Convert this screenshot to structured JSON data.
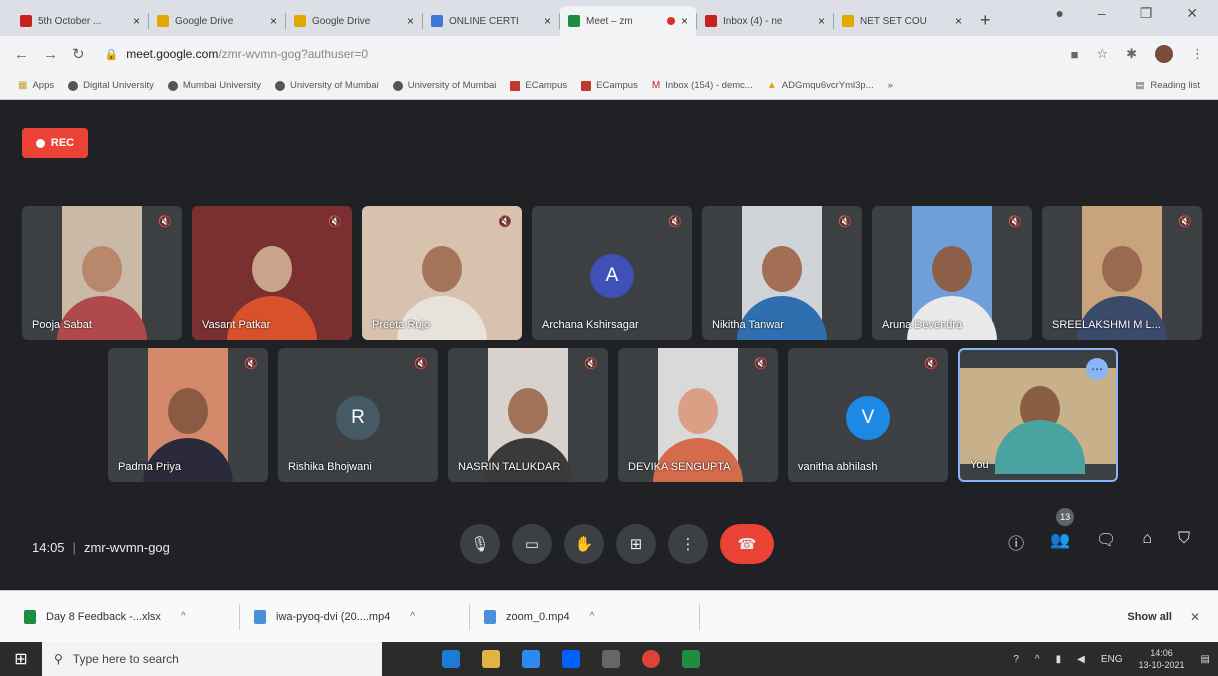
{
  "browser": {
    "tabs": [
      {
        "label": "5th October ...",
        "color": "#c5221f",
        "active": false
      },
      {
        "label": "Google Drive",
        "color": "#e0a800",
        "active": false
      },
      {
        "label": "Google Drive",
        "color": "#e0a800",
        "active": false
      },
      {
        "label": "ONLINE CERTI",
        "color": "#3c78d8",
        "active": false
      },
      {
        "label": "Meet – zm",
        "color": "#1e8e3e",
        "active": true,
        "recording": true
      },
      {
        "label": "Inbox (4) - ne",
        "color": "#c5221f",
        "active": false
      },
      {
        "label": "NET SET COU",
        "color": "#e0a800",
        "active": false
      }
    ],
    "new_tab": "+",
    "url_host": "meet.google.com",
    "url_path": "/zmr-wvmn-gog?authuser=0",
    "bookmarks": [
      {
        "label": "Apps",
        "icon": "grid"
      },
      {
        "label": "Digital University",
        "icon": "globe"
      },
      {
        "label": "Mumbai University",
        "icon": "globe"
      },
      {
        "label": "University of Mumbai",
        "icon": "globe"
      },
      {
        "label": "University of Mumbai",
        "icon": "globe"
      },
      {
        "label": "ECampus",
        "icon": "red"
      },
      {
        "label": "ECampus",
        "icon": "red"
      },
      {
        "label": "Inbox (154) - demc...",
        "icon": "gmail"
      },
      {
        "label": "ADGmqu6vcrYml3p...",
        "icon": "drive"
      }
    ],
    "reading_list": "Reading list"
  },
  "meet": {
    "rec_label": "REC",
    "participants_row1": [
      {
        "name": "Pooja Sabat",
        "type": "video",
        "bg": "#cbb9a8",
        "skin": "#b9876c",
        "cloth": "#b04a4a"
      },
      {
        "name": "Vasant Patkar",
        "type": "video",
        "bg": "#7a3030",
        "skin": "#c9a48a",
        "cloth": "#d9502d",
        "wide": true
      },
      {
        "name": "Preeta Rujo",
        "type": "video",
        "bg": "#d6c2ad",
        "skin": "#a6745a",
        "cloth": "#e8e2dc",
        "wide": true
      },
      {
        "name": "Archana Kshirsagar",
        "type": "avatar",
        "initial": "A",
        "avatar_color": "#3f51b5"
      },
      {
        "name": "Nikitha Tanwar",
        "type": "video",
        "bg": "#d0d3d8",
        "skin": "#a26f55",
        "cloth": "#2f6fb0"
      },
      {
        "name": "Aruna Devendra",
        "type": "video",
        "bg": "#6f9fd8",
        "skin": "#8d5f48",
        "cloth": "#e9e9e9"
      },
      {
        "name": "SREELAKSHMI M L...",
        "type": "video",
        "bg": "#c9a37c",
        "skin": "#9a6a50",
        "cloth": "#3a4a6a"
      }
    ],
    "participants_row2": [
      {
        "name": "Padma Priya",
        "type": "video",
        "bg": "#d48a6a",
        "skin": "#8b5a43",
        "cloth": "#2a2a3a"
      },
      {
        "name": "Rishika Bhojwani",
        "type": "avatar",
        "initial": "R",
        "avatar_color": "#455a64"
      },
      {
        "name": "NASRIN TALUKDAR",
        "type": "video",
        "bg": "#d8d2cf",
        "skin": "#a27358",
        "cloth": "#3a3a3a"
      },
      {
        "name": "DEVIKA SENGUPTA",
        "type": "video",
        "bg": "#d9d9d9",
        "skin": "#d9a085",
        "cloth": "#d36b4c"
      },
      {
        "name": "vanitha abhilash",
        "type": "avatar",
        "initial": "V",
        "avatar_color": "#1e88e5"
      },
      {
        "name": "You",
        "type": "self",
        "bg": "#c7b08a",
        "skin": "#8a5d45",
        "cloth": "#4aa3a0"
      }
    ],
    "time": "14:05",
    "meeting_code": "zmr-wvmn-gog",
    "people_count": "13"
  },
  "downloads": [
    {
      "name": "Day 8 Feedback -...xlsx",
      "color": "#1e8e3e"
    },
    {
      "name": "iwa-pyoq-dvi (20....mp4",
      "color": "#4a90d9"
    },
    {
      "name": "zoom_0.mp4",
      "color": "#4a90d9"
    }
  ],
  "downloads_show_all": "Show all",
  "taskbar": {
    "search_placeholder": "Type here to search",
    "lang": "ENG",
    "clock_time": "14:06",
    "clock_date": "13-10-2021"
  }
}
